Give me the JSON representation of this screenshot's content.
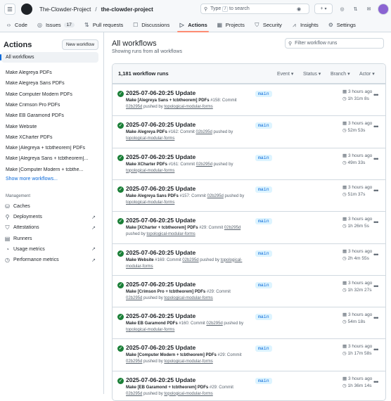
{
  "header": {
    "owner": "The-Clowder-Project",
    "repo": "the-clowder-project",
    "search_placeholder": "Type",
    "search_key": "/",
    "search_suffix": "to search",
    "plus": "+",
    "plus_caret": "▾"
  },
  "tabs": [
    {
      "label": "Code",
      "icon": "code-icon"
    },
    {
      "label": "Issues",
      "icon": "issue-icon",
      "count": "17"
    },
    {
      "label": "Pull requests",
      "icon": "pull-request-icon"
    },
    {
      "label": "Discussions",
      "icon": "discussion-icon"
    },
    {
      "label": "Actions",
      "icon": "play-icon",
      "selected": true
    },
    {
      "label": "Projects",
      "icon": "table-icon"
    },
    {
      "label": "Security",
      "icon": "shield-icon"
    },
    {
      "label": "Insights",
      "icon": "graph-icon"
    },
    {
      "label": "Settings",
      "icon": "gear-icon"
    }
  ],
  "sidebar": {
    "title": "Actions",
    "new_workflow": "New workflow",
    "all_workflows": "All workflows",
    "workflows": [
      "Make Alegreya PDFs",
      "Make Alegreya Sans PDFs",
      "Make Computer Modern PDFs",
      "Make Crimson Pro PDFs",
      "Make EB Garamond PDFs",
      "Make Website",
      "Make XCharter PDFs",
      "Make [Alegreya + tcbtheorem] PDFs",
      "Make [Alegreya Sans + tcbtheorem]...",
      "Make [Computer Modern + tcbthe..."
    ],
    "show_more": "Show more workflows...",
    "management_heading": "Management",
    "management": [
      {
        "label": "Caches",
        "icon": "cache-icon",
        "external": false
      },
      {
        "label": "Deployments",
        "icon": "rocket-icon",
        "external": true
      },
      {
        "label": "Attestations",
        "icon": "verified-icon",
        "external": true
      },
      {
        "label": "Runners",
        "icon": "server-icon",
        "external": false
      },
      {
        "label": "Usage metrics",
        "icon": "metrics-icon",
        "external": true
      },
      {
        "label": "Performance metrics",
        "icon": "performance-icon",
        "external": true
      }
    ]
  },
  "main": {
    "title": "All workflows",
    "subtitle": "Showing runs from all workflows",
    "filter_placeholder": "Filter workflow runs",
    "run_count": "1,181 workflow runs",
    "filters": [
      "Event",
      "Status",
      "Branch",
      "Actor"
    ],
    "runs": [
      {
        "title": "2025-07-06-20:25 Update",
        "workflow": "Make [Alegreya Sans + tcbtheorem] PDFs",
        "num": "#158",
        "commit": "02b295d",
        "user": "topological-modular-forms",
        "branch": "main",
        "ago": "3 hours ago",
        "duration": "1h 31m 8s"
      },
      {
        "title": "2025-07-06-20:25 Update",
        "workflow": "Make Alegreya PDFs",
        "num": "#162",
        "commit": "02b295d",
        "user": "topological-modular-forms",
        "branch": "main",
        "ago": "3 hours ago",
        "duration": "52m 53s"
      },
      {
        "title": "2025-07-06-20:25 Update",
        "workflow": "Make XCharter PDFs",
        "num": "#161",
        "commit": "02b295d",
        "user": "topological-modular-forms",
        "branch": "main",
        "ago": "3 hours ago",
        "duration": "49m 33s"
      },
      {
        "title": "2025-07-06-20:25 Update",
        "workflow": "Make Alegreya Sans PDFs",
        "num": "#157",
        "commit": "02b295d",
        "user": "topological-modular-forms",
        "branch": "main",
        "ago": "3 hours ago",
        "duration": "51m 37s"
      },
      {
        "title": "2025-07-06-20:25 Update",
        "workflow": "Make [XCharter + tcbtheorem] PDFs",
        "num": "#29",
        "commit": "02b295d",
        "user": "topological-modular-forms",
        "branch": "main",
        "ago": "3 hours ago",
        "duration": "1h 26m 5s"
      },
      {
        "title": "2025-07-06-20:25 Update",
        "workflow": "Make Website",
        "num": "#169",
        "commit": "02b295d",
        "user": "topological-modular-forms",
        "branch": "main",
        "ago": "3 hours ago",
        "duration": "2h 4m 55s"
      },
      {
        "title": "2025-07-06-20:25 Update",
        "workflow": "Make [Crimson Pro + tcbtheorem] PDFs",
        "num": "#29",
        "commit": "02b295d",
        "user": "topological-modular-forms",
        "branch": "main",
        "ago": "3 hours ago",
        "duration": "1h 32m 27s"
      },
      {
        "title": "2025-07-06-20:25 Update",
        "workflow": "Make EB Garamond PDFs",
        "num": "#160",
        "commit": "02b295d",
        "user": "topological-modular-forms",
        "branch": "main",
        "ago": "3 hours ago",
        "duration": "54m 18s"
      },
      {
        "title": "2025-07-06-20:25 Update",
        "workflow": "Make [Computer Modern + tcbtheorem] PDFs",
        "num": "#29",
        "commit": "02b295d",
        "user": "topological-modular-forms",
        "branch": "main",
        "ago": "3 hours ago",
        "duration": "1h 17m 58s"
      },
      {
        "title": "2025-07-06-20:25 Update",
        "workflow": "Make [EB Garamond + tcbtheorem] PDFs",
        "num": "#29",
        "commit": "02b295d",
        "user": "topological-modular-forms",
        "branch": "main",
        "ago": "3 hours ago",
        "duration": "1h 36m 14s"
      }
    ]
  }
}
